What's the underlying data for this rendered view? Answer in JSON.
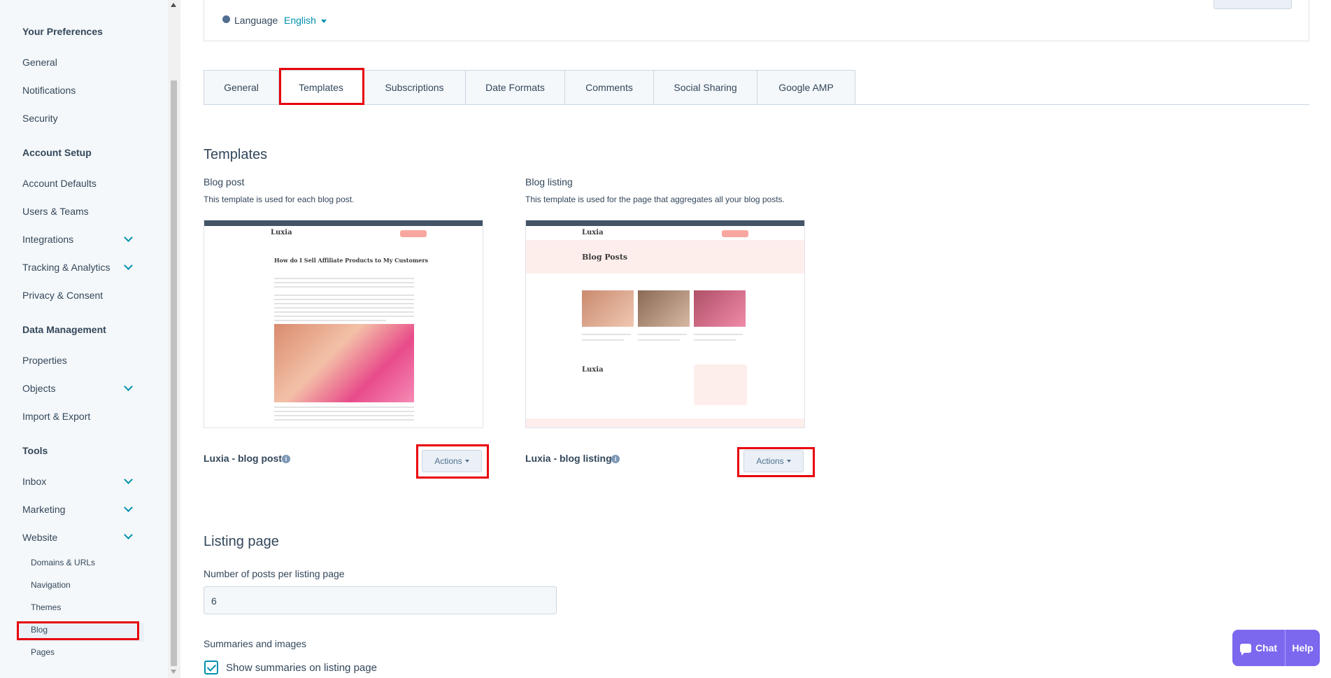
{
  "sidebar": {
    "sections": {
      "preferences": "Your Preferences",
      "account_setup": "Account Setup",
      "data_management": "Data Management",
      "tools": "Tools"
    },
    "items": {
      "general": "General",
      "notifications": "Notifications",
      "security": "Security",
      "account_defaults": "Account Defaults",
      "users_teams": "Users & Teams",
      "integrations": "Integrations",
      "tracking": "Tracking & Analytics",
      "privacy": "Privacy & Consent",
      "properties": "Properties",
      "objects": "Objects",
      "import_export": "Import & Export",
      "inbox": "Inbox",
      "marketing": "Marketing",
      "website": "Website"
    },
    "website_sub": {
      "domains": "Domains & URLs",
      "navigation": "Navigation",
      "themes": "Themes",
      "blog": "Blog",
      "pages": "Pages"
    }
  },
  "language": {
    "label": "Language",
    "value": "English"
  },
  "tabs": [
    "General",
    "Templates",
    "Subscriptions",
    "Date Formats",
    "Comments",
    "Social Sharing",
    "Google AMP"
  ],
  "templates": {
    "heading": "Templates",
    "blog_post": {
      "label": "Blog post",
      "help": "This template is used for each blog post.",
      "name": "Luxia - blog post",
      "preview_logo": "Luxia",
      "preview_title": "How do I Sell Affiliate Products to My Customers"
    },
    "blog_listing": {
      "label": "Blog listing",
      "help": "This template is used for the page that aggregates all your blog posts.",
      "name": "Luxia - blog listing",
      "preview_logo": "Luxia",
      "preview_title": "Blog Posts"
    },
    "actions_label": "Actions"
  },
  "listing_page": {
    "heading": "Listing page",
    "posts_label": "Number of posts per listing page",
    "posts_value": "6",
    "summaries_label": "Summaries and images",
    "show_summaries": "Show summaries on listing page"
  },
  "chat_widget": {
    "chat": "Chat",
    "help": "Help"
  }
}
